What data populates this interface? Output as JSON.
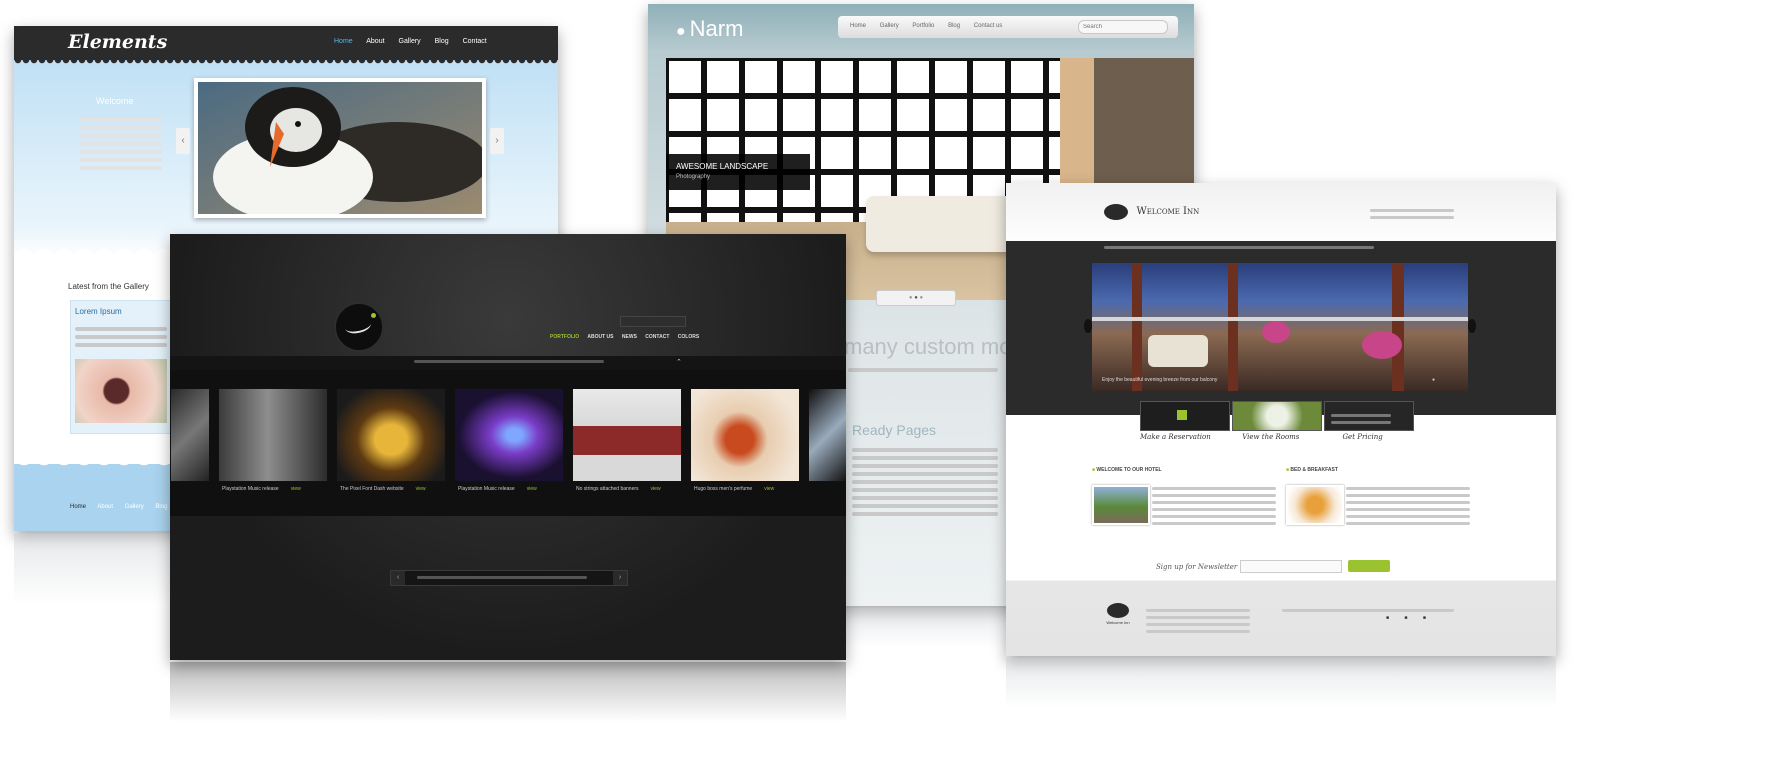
{
  "elements": {
    "logo": "Elements",
    "nav": [
      "Home",
      "About",
      "Gallery",
      "Blog",
      "Contact"
    ],
    "welcome": "Welcome",
    "gallery_heading": "Latest from the Gallery",
    "card_title": "Lorem Ipsum",
    "footer_nav": [
      "Home",
      "About",
      "Gallery",
      "Blog"
    ]
  },
  "narm": {
    "logo": "Narm",
    "nav": [
      "Home",
      "Gallery",
      "Portfolio",
      "Blog",
      "Contact us"
    ],
    "search_placeholder": "Search",
    "caption_title": "AWESOME LANDSCAPE",
    "caption_sub": "Photography",
    "tagline": "many custom mo",
    "section_heading": "Ready Pages"
  },
  "dark": {
    "nav": [
      "PORTFOLIO",
      "ABOUT US",
      "NEWS",
      "CONTACT",
      "COLORS"
    ]
  },
  "inn": {
    "logo": "Welcome Inn",
    "slider_caption": "Enjoy the beautiful evening breeze from our balcony",
    "tabs": [
      "Make a Reservation",
      "View the Rooms",
      "Get Pricing"
    ],
    "section_1": "WELCOME TO OUR HOTEL",
    "section_2": "BED & BREAKFAST",
    "newsletter_label": "Sign up for Newsletter",
    "footer_logo": "Welcome Inn"
  },
  "colors": {
    "accent_green": "#9bc22f",
    "sky_blue": "#a9d3ee",
    "dark_bg": "#1e1e1e"
  }
}
